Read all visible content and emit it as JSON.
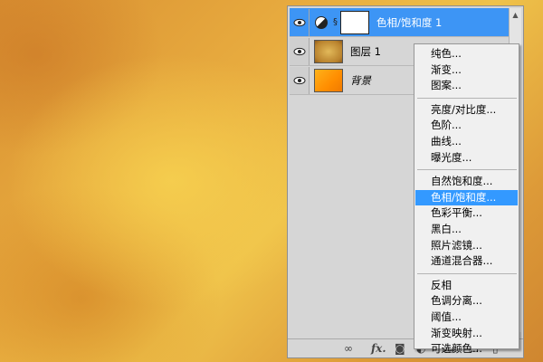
{
  "layers_panel": {
    "layers": [
      {
        "name": "色相/饱和度 1",
        "type": "adjustment",
        "selected": true
      },
      {
        "name": "图层 1",
        "type": "texture",
        "selected": false
      },
      {
        "name": "背景",
        "type": "background",
        "selected": false
      }
    ],
    "bottom_icons": [
      "link-icon",
      "fx-icon",
      "mask-icon",
      "adjustment-icon",
      "folder-icon",
      "new-layer-icon",
      "trash-icon"
    ],
    "fx_label": "fx."
  },
  "adjustment_menu": {
    "highlighted": "色相/饱和度...",
    "groups": [
      [
        "纯色...",
        "渐变...",
        "图案..."
      ],
      [
        "亮度/对比度...",
        "色阶...",
        "曲线...",
        "曝光度..."
      ],
      [
        "自然饱和度...",
        "色相/饱和度...",
        "色彩平衡...",
        "黑白...",
        "照片滤镜...",
        "通道混合器..."
      ],
      [
        "反相",
        "色调分离...",
        "阈值...",
        "渐变映射...",
        "可选颜色..."
      ]
    ]
  },
  "colors": {
    "selection_blue": "#3d95f5",
    "menu_highlight": "#3399ff",
    "panel_bg": "#d6d6d6",
    "canvas_orange": "#e8ac3f"
  }
}
